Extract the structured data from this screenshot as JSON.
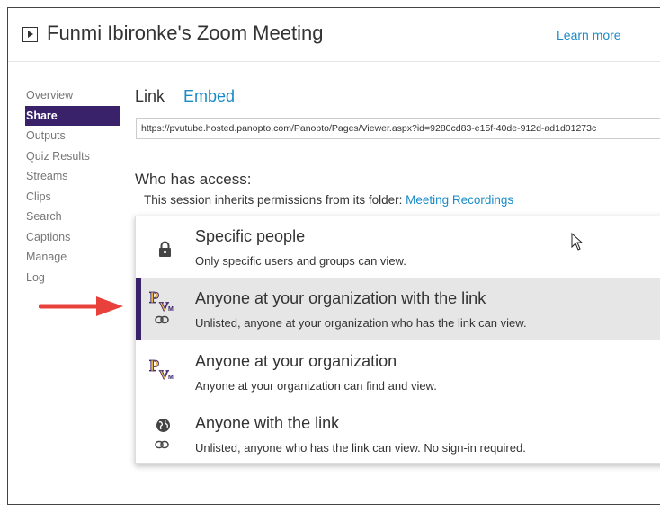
{
  "header": {
    "title": "Funmi Ibironke's Zoom Meeting",
    "learn_more": "Learn more",
    "icon": "play-square-icon"
  },
  "sidebar": {
    "items": [
      {
        "label": "Overview",
        "active": false
      },
      {
        "label": "Share",
        "active": true
      },
      {
        "label": "Outputs",
        "active": false
      },
      {
        "label": "Quiz Results",
        "active": false
      },
      {
        "label": "Streams",
        "active": false
      },
      {
        "label": "Clips",
        "active": false
      },
      {
        "label": "Search",
        "active": false
      },
      {
        "label": "Captions",
        "active": false
      },
      {
        "label": "Manage",
        "active": false
      },
      {
        "label": "Log",
        "active": false
      }
    ]
  },
  "share": {
    "tab_link": "Link",
    "tab_embed": "Embed",
    "url": "https://pvutube.hosted.panopto.com/Panopto/Pages/Viewer.aspx?id=9280cd83-e15f-40de-912d-ad1d01273c",
    "access_heading": "Who has access:",
    "inherit_text": "This session inherits permissions from its folder: ",
    "inherit_link": "Meeting Recordings"
  },
  "options": [
    {
      "title": "Specific people",
      "desc": "Only specific users and groups can view.",
      "icon": "lock-icon",
      "selected": false
    },
    {
      "title": "Anyone at your organization with the link",
      "desc": "Unlisted, anyone at your organization who has the link can view.",
      "icon": "pv-logo-icon",
      "selected": true
    },
    {
      "title": "Anyone at your organization",
      "desc": "Anyone at your organization can find and view.",
      "icon": "pv-logo-icon",
      "selected": false
    },
    {
      "title": "Anyone with the link",
      "desc": "Unlisted, anyone who has the link can view. No sign-in required.",
      "icon": "globe-icon",
      "selected": false
    }
  ],
  "colors": {
    "accent_purple": "#3a226b",
    "link_blue": "#1a8bc7",
    "arrow_red": "#e8413c",
    "logo_gold": "#e8b64a"
  }
}
